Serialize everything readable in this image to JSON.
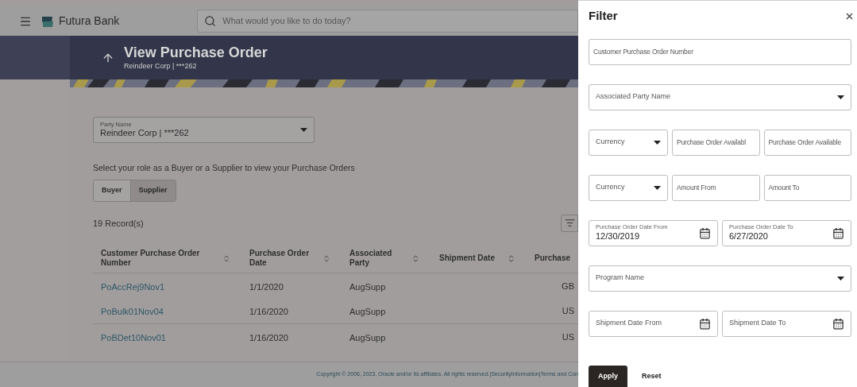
{
  "header": {
    "brand": "Futura Bank",
    "search": {
      "placeholder": "What would you like to do today?"
    }
  },
  "banner": {
    "title": "View Purchase Order",
    "subtitle": "Reindeer Corp | ***262"
  },
  "party_select": {
    "label": "Party Name",
    "value": "Reindeer Corp | ***262"
  },
  "role_prompt": "Select your role as a Buyer or a Supplier to view your Purchase Orders",
  "roles": [
    {
      "label": "Buyer",
      "selected": false
    },
    {
      "label": "Supplier",
      "selected": true
    }
  ],
  "record_count": "19 Record(s)",
  "table": {
    "columns": [
      "Customer Purchase Order Number",
      "Purchase Order Date",
      "Associated Party",
      "Shipment Date",
      "Purchase"
    ],
    "rows": [
      {
        "number": "PoAccRej9Nov1",
        "date": "1/1/2020",
        "party": "AugSupp",
        "shipment": "",
        "column_5": "GB"
      },
      {
        "number": "PoBulk01Nov04",
        "date": "1/16/2020",
        "party": "AugSupp",
        "shipment": "",
        "column_5": "US"
      },
      {
        "number": "PoBDet10Nov01",
        "date": "1/16/2020",
        "party": "AugSupp",
        "shipment": "",
        "column_5": "US"
      }
    ]
  },
  "footer": "Copyright © 2006, 2023, Oracle and/or its affiliates. All rights reserved.|SecurityInformation|Terms and Con",
  "filter": {
    "title": "Filter",
    "rows": [
      {
        "fields": [
          {
            "kind": "text",
            "placeholder": "Customer Purchase Order Number"
          }
        ]
      },
      {
        "fields": [
          {
            "kind": "select",
            "placeholder": "Associated Party Name"
          }
        ]
      },
      {
        "fields": [
          {
            "kind": "select",
            "placeholder": "Currency"
          },
          {
            "kind": "text",
            "placeholder": "Purchase Order Availabl"
          },
          {
            "kind": "text",
            "placeholder": "Purchase Order Available"
          }
        ]
      },
      {
        "fields": [
          {
            "kind": "select",
            "placeholder": "Currency"
          },
          {
            "kind": "text",
            "placeholder": "Amount From"
          },
          {
            "kind": "text",
            "placeholder": "Amount To"
          }
        ]
      },
      {
        "fields": [
          {
            "kind": "date",
            "label": "Purchase Order Date From",
            "value": "12/30/2019"
          },
          {
            "kind": "date",
            "label": "Purchase Order Date To",
            "value": "6/27/2020"
          }
        ]
      },
      {
        "fields": [
          {
            "kind": "select",
            "placeholder": "Program Name"
          }
        ]
      },
      {
        "fields": [
          {
            "kind": "date",
            "placeholder": "Shipment Date From"
          },
          {
            "kind": "date",
            "placeholder": "Shipment Date To"
          }
        ]
      }
    ],
    "buttons": [
      {
        "label": "Apply",
        "kind": "primary"
      },
      {
        "label": "Reset",
        "kind": "secondary"
      }
    ]
  }
}
